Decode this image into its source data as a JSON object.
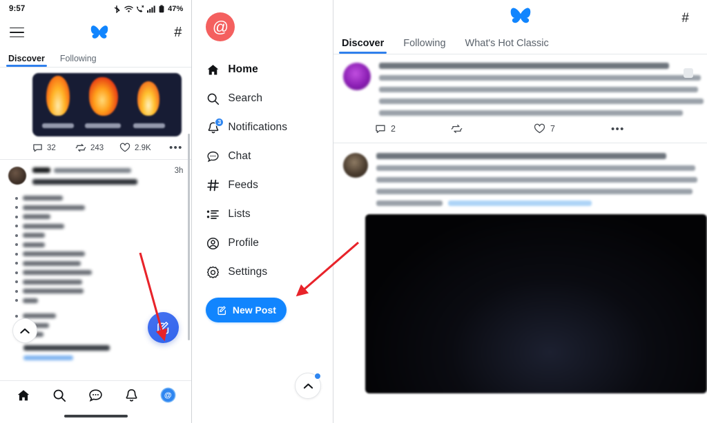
{
  "phone": {
    "status_bar": {
      "time": "9:57",
      "battery": "47%",
      "icons": [
        "bluetooth-icon",
        "wifi-icon",
        "call-icon",
        "signal-icon",
        "battery-icon"
      ]
    },
    "header": {
      "menu_icon": "hamburger-icon",
      "logo": "butterfly-logo",
      "right_icon": "hash-icon"
    },
    "tabs": [
      {
        "label": "Discover",
        "active": true
      },
      {
        "label": "Following",
        "active": false
      }
    ],
    "first_post": {
      "actions": [
        {
          "icon": "comment-icon",
          "count": "32"
        },
        {
          "icon": "repost-icon",
          "count": "243"
        },
        {
          "icon": "like-icon",
          "count": "2.9K"
        },
        {
          "icon": "more-icon",
          "count": "•••"
        }
      ]
    },
    "second_post": {
      "timestamp": "3h"
    },
    "scroll_top_icon": "chevron-up-icon",
    "fab": {
      "icon": "compose-icon",
      "color": "#3264ec"
    },
    "bottom_nav": [
      {
        "icon": "home-icon",
        "active": true
      },
      {
        "icon": "search-icon",
        "active": false
      },
      {
        "icon": "chat-icon",
        "active": false
      },
      {
        "icon": "bell-icon",
        "active": false
      },
      {
        "icon": "account-avatar-icon",
        "active": false,
        "glyph": "@"
      }
    ]
  },
  "drawer": {
    "avatar": {
      "glyph": "@",
      "color": "#f4605f"
    },
    "items": [
      {
        "label": "Home",
        "icon": "home-icon",
        "active": true,
        "badge": ""
      },
      {
        "label": "Search",
        "icon": "search-icon",
        "active": false,
        "badge": ""
      },
      {
        "label": "Notifications",
        "icon": "bell-icon",
        "active": false,
        "badge": "3"
      },
      {
        "label": "Chat",
        "icon": "chat-icon",
        "active": false,
        "badge": ""
      },
      {
        "label": "Feeds",
        "icon": "hash-icon",
        "active": false,
        "badge": ""
      },
      {
        "label": "Lists",
        "icon": "list-icon",
        "active": false,
        "badge": ""
      },
      {
        "label": "Profile",
        "icon": "profile-icon",
        "active": false,
        "badge": ""
      },
      {
        "label": "Settings",
        "icon": "gear-icon",
        "active": false,
        "badge": ""
      }
    ],
    "new_post": {
      "label": "New Post",
      "icon": "compose-icon",
      "color": "#1185fe"
    },
    "scroll_top_icon": "chevron-up-icon"
  },
  "desktop": {
    "header": {
      "logo": "butterfly-logo",
      "right_icon": "hash-icon"
    },
    "tabs": [
      {
        "label": "Discover",
        "active": true
      },
      {
        "label": "Following",
        "active": false
      },
      {
        "label": "What's Hot Classic",
        "active": false
      }
    ],
    "post_one": {
      "actions": [
        {
          "icon": "comment-icon",
          "count": "2"
        },
        {
          "icon": "repost-icon",
          "count": ""
        },
        {
          "icon": "like-icon",
          "count": "7"
        },
        {
          "icon": "more-icon",
          "count": "•••"
        }
      ]
    }
  },
  "annotations": {
    "arrow_color": "#e8232a",
    "arrows": [
      {
        "name": "arrow-to-fab",
        "target": "compose-fab"
      },
      {
        "name": "arrow-to-new-post",
        "target": "new-post-button"
      }
    ]
  }
}
